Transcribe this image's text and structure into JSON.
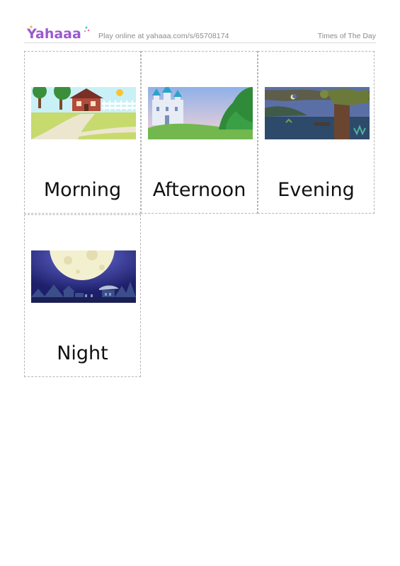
{
  "header": {
    "logo_text": "Yahaaa",
    "play_prefix": "Play online at ",
    "play_link": "yahaaa.com/s/65708174",
    "document_title": "Times of The Day"
  },
  "cards": [
    {
      "word": "Morning",
      "image_icon": "morning-scene-icon"
    },
    {
      "word": "Afternoon",
      "image_icon": "afternoon-scene-icon"
    },
    {
      "word": "Evening",
      "image_icon": "evening-scene-icon"
    },
    {
      "word": "Night",
      "image_icon": "night-scene-icon"
    }
  ],
  "colors": {
    "logo_primary": "#9b59d0",
    "logo_accent": "#4ab3e8",
    "text_muted": "#8a8a8a",
    "card_border": "#b5b5b5"
  }
}
